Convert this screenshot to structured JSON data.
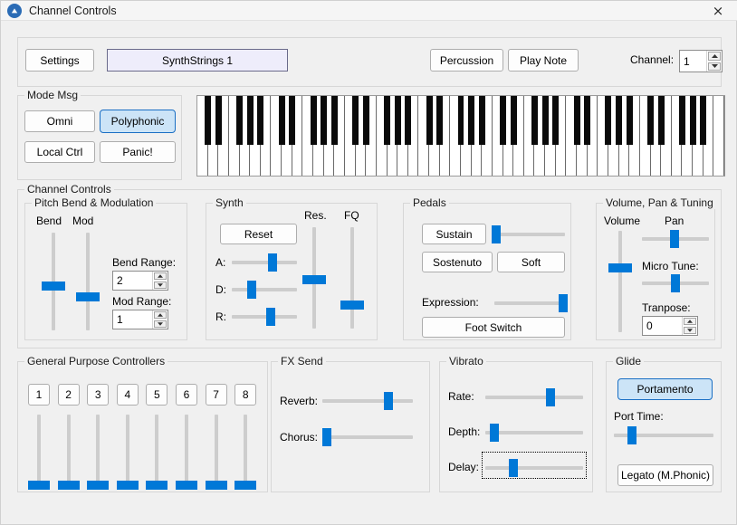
{
  "window": {
    "title": "Channel Controls",
    "app_icon": "app-circle-triangle-icon",
    "close_icon": "×"
  },
  "toolbar": {
    "settings_label": "Settings",
    "patch_label": "SynthStrings 1",
    "percussion_label": "Percussion",
    "play_note_label": "Play Note",
    "channel_label": "Channel:",
    "channel_value": "1"
  },
  "mode_msg": {
    "title": "Mode Msg",
    "buttons": [
      {
        "label": "Omni",
        "active": false
      },
      {
        "label": "Polyphonic",
        "active": true
      },
      {
        "label": "Local Ctrl",
        "active": false
      },
      {
        "label": "Panic!",
        "active": false
      }
    ]
  },
  "keyboard": {
    "octaves": 7,
    "white_keys": 50
  },
  "channel_controls": {
    "title": "Channel Controls"
  },
  "pitch_bend": {
    "title": "Pitch Bend & Modulation",
    "bend_label": "Bend",
    "mod_label": "Mod",
    "bend_value": 45,
    "mod_value": 34,
    "bend_range_label": "Bend Range:",
    "bend_range_value": "2",
    "mod_range_label": "Mod Range:",
    "mod_range_value": "1"
  },
  "synth": {
    "title": "Synth",
    "reset_label": "Reset",
    "res_label": "Res.",
    "fq_label": "FQ",
    "a_label": "A:",
    "d_label": "D:",
    "r_label": "R:",
    "a_value": 63,
    "d_value": 30,
    "r_value": 60,
    "res_value": 48,
    "fq_value": 23
  },
  "pedals": {
    "title": "Pedals",
    "sustain_label": "Sustain",
    "sostenuto_label": "Sostenuto",
    "soft_label": "Soft",
    "sustain_value": 3,
    "expression_label": "Expression:",
    "expression_value": 97,
    "foot_switch_label": "Foot Switch"
  },
  "volume_pan": {
    "title": "Volume, Pan & Tuning",
    "volume_label": "Volume",
    "volume_value": 63,
    "pan_label": "Pan",
    "pan_value": 49,
    "micro_tune_label": "Micro Tune:",
    "micro_tune_value": 50,
    "transpose_label": "Tranpose:",
    "transpose_value": "0"
  },
  "gp_controllers": {
    "title": "General Purpose Controllers",
    "buttons": [
      "1",
      "2",
      "3",
      "4",
      "5",
      "6",
      "7",
      "8"
    ],
    "slider_values": [
      0,
      0,
      0,
      0,
      0,
      0,
      0,
      0
    ]
  },
  "fx_send": {
    "title": "FX Send",
    "reverb_label": "Reverb:",
    "reverb_value": 73,
    "chorus_label": "Chorus:",
    "chorus_value": 5
  },
  "vibrato": {
    "title": "Vibrato",
    "rate_label": "Rate:",
    "rate_value": 67,
    "depth_label": "Depth:",
    "depth_value": 9,
    "delay_label": "Delay:",
    "delay_value": 29,
    "delay_focused": true
  },
  "glide": {
    "title": "Glide",
    "portamento_label": "Portamento",
    "portamento_active": true,
    "port_time_label": "Port Time:",
    "port_time_value": 18,
    "legato_label": "Legato (M.Phonic)"
  },
  "colors": {
    "accent": "#0078d7",
    "active_fill": "#cce4f7",
    "active_border": "#1a6fc4",
    "window_bg": "#f0f0f0",
    "patch_bg": "#eeedfb"
  }
}
